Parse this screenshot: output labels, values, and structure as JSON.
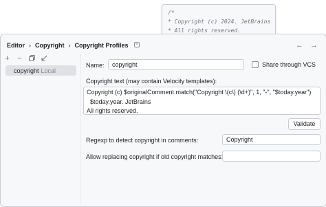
{
  "breadcrumb": [
    "Editor",
    "Copyright",
    "Copyright Profiles"
  ],
  "profiles": [
    {
      "name": "copyright",
      "tag": "Local"
    }
  ],
  "form": {
    "name_label": "Name:",
    "name_value": "copyright",
    "share_label": "Share through VCS",
    "copyright_text_label": "Copyright text (may contain Velocity templates):",
    "text_lines": [
      "Copyright (c) $originalComment.match(\"Copyright \\(c\\) (\\d+)\", 1, \"-\", \"$today.year\")",
      "$today.year. JetBrains",
      "All rights reserved."
    ],
    "validate_label": "Validate",
    "regexp_label": "Regexp to detect copyright in comments:",
    "regexp_value": "Copyright",
    "allow_label": "Allow replacing copyright if old copyright matches:",
    "allow_value": ""
  },
  "tooltip": {
    "lines": [
      "/*",
      " * Copyright (c) 2024. JetBrains",
      " * All rights reserved.",
      " */"
    ]
  },
  "icons": {
    "add": "plus-icon",
    "remove": "minus-icon",
    "copy": "copy-icon",
    "import": "import-icon",
    "settings_page": "page-settings-icon",
    "back": "arrow-left-icon",
    "forward": "arrow-right-icon"
  }
}
